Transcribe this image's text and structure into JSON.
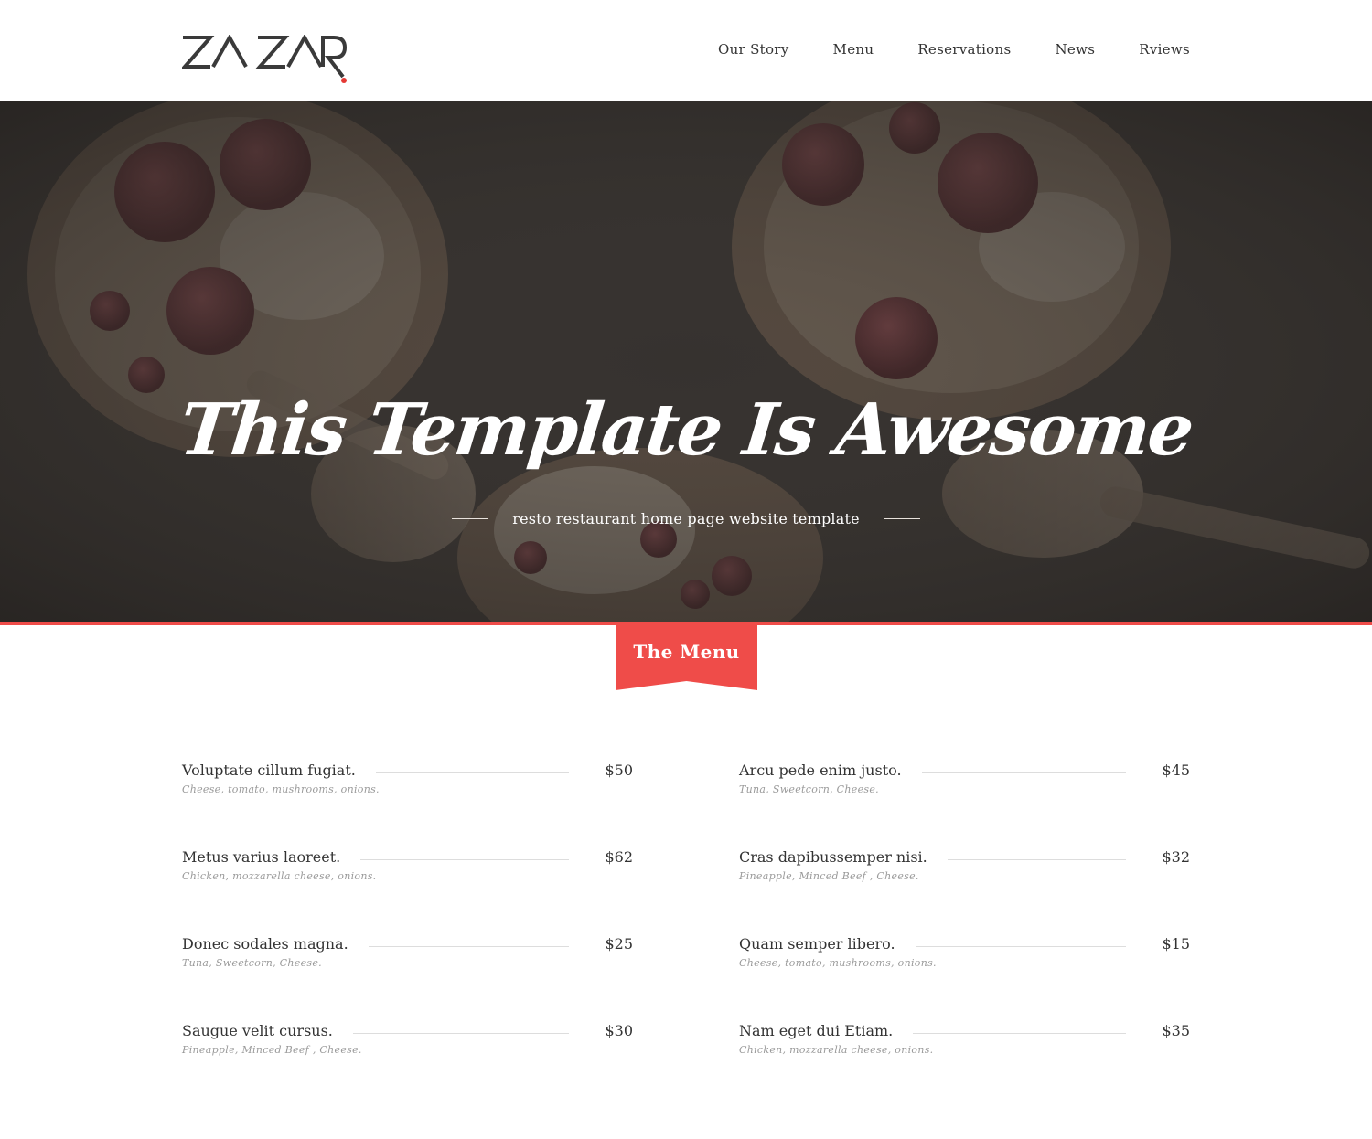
{
  "header": {
    "logo_text": "ZA ZAR",
    "nav": [
      "Our Story",
      "Menu",
      "Reservations",
      "News",
      "Rviews"
    ]
  },
  "hero": {
    "title": "This Template Is Awesome",
    "subtitle": "resto restaurant home page website template"
  },
  "menu_section": {
    "title": "The Menu",
    "left": [
      {
        "name": "Voluptate cillum fugiat.",
        "desc": "Cheese, tomato, mushrooms, onions.",
        "price": "$50"
      },
      {
        "name": "Metus varius laoreet.",
        "desc": "Chicken, mozzarella cheese, onions.",
        "price": "$62"
      },
      {
        "name": "Donec sodales magna.",
        "desc": "Tuna, Sweetcorn, Cheese.",
        "price": "$25"
      },
      {
        "name": "Saugue velit cursus.",
        "desc": "Pineapple, Minced Beef , Cheese.",
        "price": "$30"
      }
    ],
    "right": [
      {
        "name": "Arcu pede enim justo.",
        "desc": "Tuna, Sweetcorn, Cheese.",
        "price": "$45"
      },
      {
        "name": "Cras dapibussemper nisi.",
        "desc": "Pineapple, Minced Beef , Cheese.",
        "price": "$32"
      },
      {
        "name": "Quam semper libero.",
        "desc": "Cheese, tomato, mushrooms, onions.",
        "price": "$15"
      },
      {
        "name": "Nam eget dui Etiam.",
        "desc": "Chicken, mozzarella cheese, onions.",
        "price": "$35"
      }
    ]
  },
  "colors": {
    "accent": "#ef4c49",
    "text": "#333333",
    "muted": "#9a9a9a"
  }
}
